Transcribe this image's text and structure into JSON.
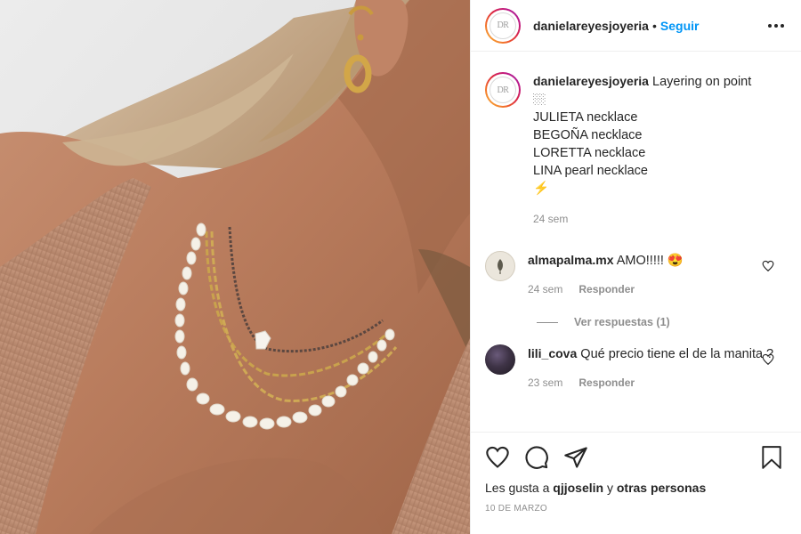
{
  "account": {
    "username": "danielareyesjoyeria",
    "avatar_text": "DR",
    "follow_label": "Seguir",
    "separator": "•"
  },
  "caption": {
    "username": "danielareyesjoyeria",
    "lines": [
      "Layering on point 🏼",
      "JULIETA necklace",
      "BEGOÑA necklace",
      "LORETTA necklace",
      "LINA pearl necklace",
      "⚡"
    ],
    "time": "24 sem"
  },
  "comments": [
    {
      "username": "almapalma.mx",
      "text": "AMO!!!!! 😍",
      "time": "24 sem",
      "reply_label": "Responder"
    },
    {
      "username": "lili_cova",
      "text": "Qué precio tiene el de la manita ?",
      "time": "23 sem",
      "reply_label": "Responder"
    }
  ],
  "view_replies": "Ver respuestas (1)",
  "likes": {
    "prefix": "Les gusta a",
    "user": "qjjoselin",
    "conj": "y",
    "others": "otras personas"
  },
  "date": "10 DE MARZO",
  "icons": {
    "more": "more-horizontal-icon",
    "like": "heart-icon",
    "comment": "comment-bubble-icon",
    "share": "paper-plane-icon",
    "save": "bookmark-icon"
  },
  "colors": {
    "link_blue": "#0095f6",
    "muted": "#8e8e8e",
    "text": "#262626"
  }
}
